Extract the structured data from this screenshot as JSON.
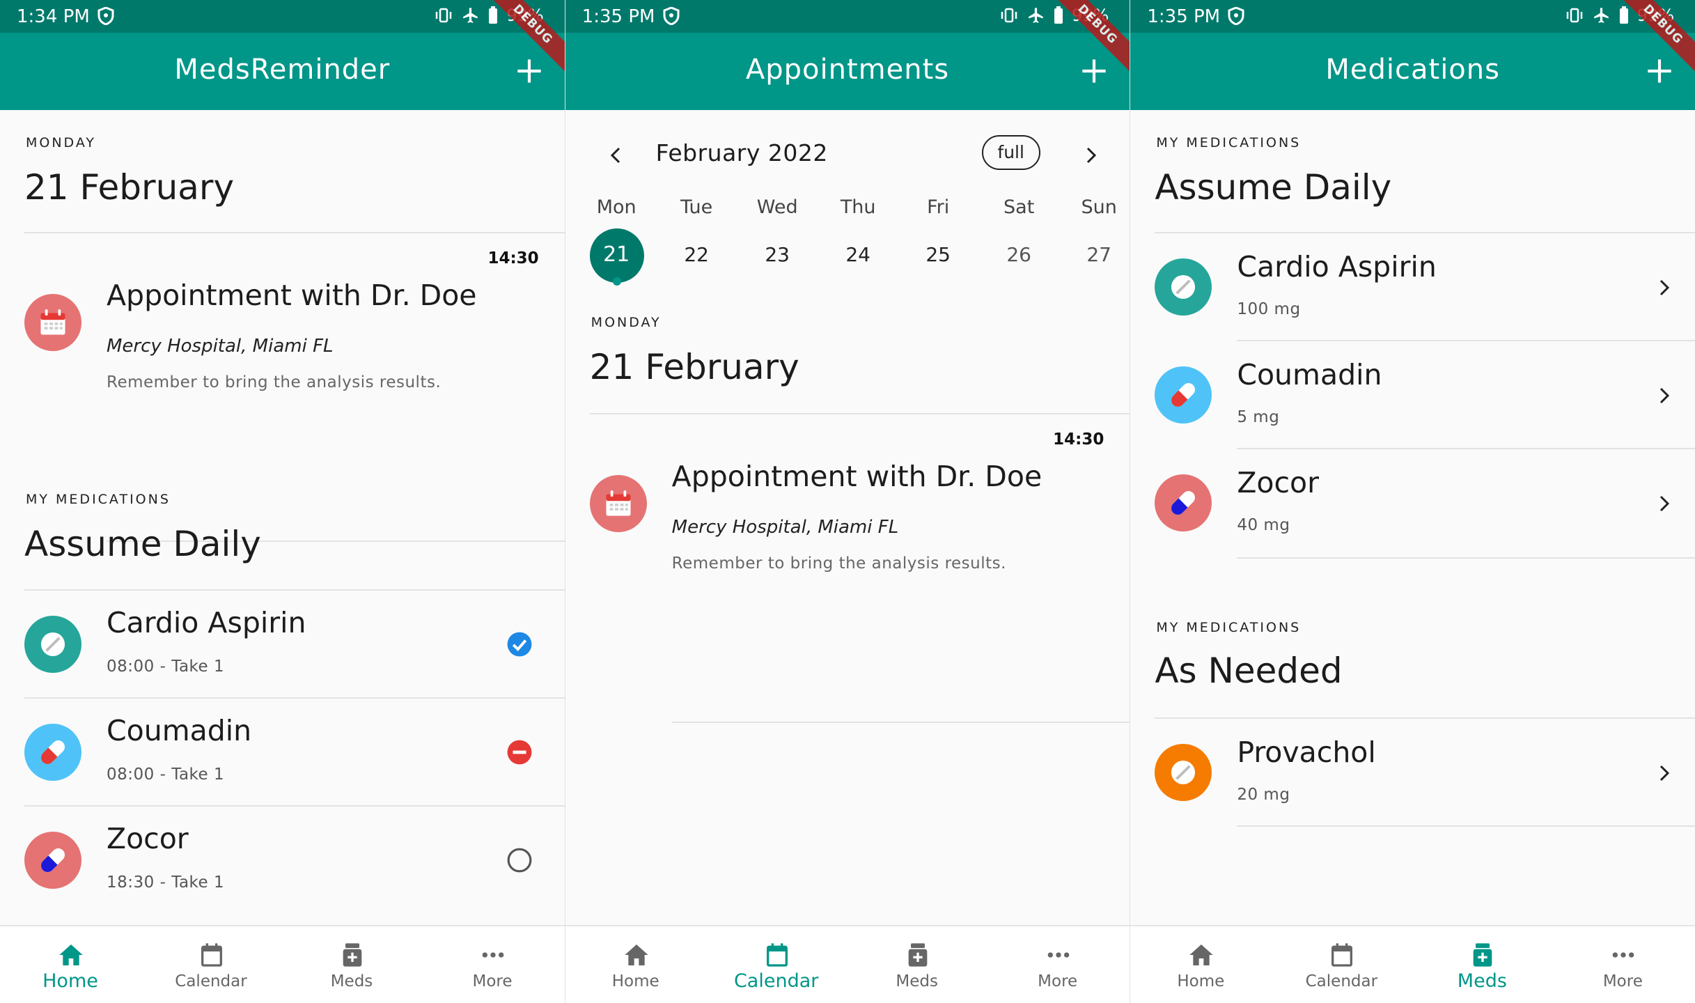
{
  "status_bars": [
    {
      "time": "1:34 PM",
      "battery": "99%"
    },
    {
      "time": "1:35 PM",
      "battery": "99%"
    },
    {
      "time": "1:35 PM",
      "battery": "99%"
    }
  ],
  "debug_label": "DEBUG",
  "colors": {
    "primary": "#009688",
    "primary_dark": "#00796b",
    "taken": "#1e88e5",
    "skipped": "#e53935"
  },
  "home": {
    "title": "MedsReminder",
    "day_name": "MONDAY",
    "date": "21 February",
    "appointment": {
      "time": "14:30",
      "title": "Appointment with Dr. Doe",
      "place": "Mercy Hospital, Miami FL",
      "note": "Remember to bring the analysis results."
    },
    "meds_section": "MY MEDICATIONS",
    "meds_group": "Assume Daily",
    "meds": [
      {
        "name": "Cardio Aspirin",
        "detail": "08:00 - Take 1",
        "status": "taken",
        "icon": "tablet-icon"
      },
      {
        "name": "Coumadin",
        "detail": "08:00 - Take 1",
        "status": "skipped",
        "icon": "capsule-icon"
      },
      {
        "name": "Zocor",
        "detail": "18:30 - Take 1",
        "status": "pending",
        "icon": "capsule-icon"
      }
    ]
  },
  "appointments": {
    "title": "Appointments",
    "month": "February 2022",
    "format_button": "full",
    "weekdays": [
      "Mon",
      "Tue",
      "Wed",
      "Thu",
      "Fri",
      "Sat",
      "Sun"
    ],
    "days": [
      "21",
      "22",
      "23",
      "24",
      "25",
      "26",
      "27"
    ],
    "selected_day": "21",
    "day_name": "MONDAY",
    "date": "21 February",
    "appointment": {
      "time": "14:30",
      "title": "Appointment with Dr. Doe",
      "place": "Mercy Hospital, Miami FL",
      "note": "Remember to bring the analysis results."
    }
  },
  "medications": {
    "title": "Medications",
    "daily_section": "MY MEDICATIONS",
    "daily_group": "Assume Daily",
    "daily": [
      {
        "name": "Cardio Aspirin",
        "dose": "100 mg"
      },
      {
        "name": "Coumadin",
        "dose": "5 mg"
      },
      {
        "name": "Zocor",
        "dose": "40 mg"
      }
    ],
    "needed_section": "MY MEDICATIONS",
    "needed_group": "As Needed",
    "needed": [
      {
        "name": "Provachol",
        "dose": "20 mg"
      }
    ]
  },
  "nav": [
    "Home",
    "Calendar",
    "Meds",
    "More"
  ]
}
